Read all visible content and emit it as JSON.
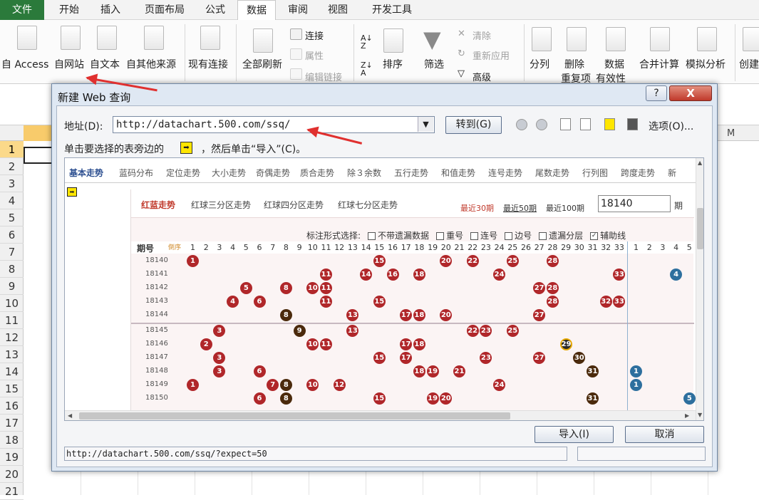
{
  "ribbon_tabs": [
    "文件",
    "开始",
    "插入",
    "页面布局",
    "公式",
    "数据",
    "审阅",
    "视图",
    "开发工具"
  ],
  "ribbon": {
    "access": "自 Access",
    "web": "自网站",
    "text": "自文本",
    "other": "自其他来源",
    "existing": "现有连接",
    "refresh_all": "全部刷新",
    "connections": "连接",
    "properties": "属性",
    "edit_links": "编辑链接",
    "sort": "排序",
    "filter": "筛选",
    "clear": "清除",
    "reapply": "重新应用",
    "advanced": "高级",
    "split": "分列",
    "remove_dup_1": "删除",
    "remove_dup_2": "重复项",
    "validation_1": "数据",
    "validation_2": "有效性",
    "consolidate": "合并计算",
    "what_if": "模拟分析",
    "create": "创建"
  },
  "sheet": {
    "rows": [
      "1",
      "2",
      "3",
      "4",
      "5",
      "6",
      "7",
      "8",
      "9",
      "10",
      "11",
      "12",
      "13",
      "14",
      "15",
      "16",
      "17",
      "18",
      "19",
      "20",
      "21"
    ],
    "col_m": "M"
  },
  "dialog": {
    "title": "新建 Web 查询",
    "help": "?",
    "close": "X",
    "address_label": "地址(D):",
    "address_value": "http://datachart.500.com/ssq/",
    "go_button": "转到(G)",
    "options_label": "选项(O)...",
    "hint_before": "单击要选择的表旁边的",
    "hint_after": "，然后单击“导入”(C)。",
    "import_button": "导入(I)",
    "cancel_button": "取消",
    "status_url": "http://datachart.500.com/ssq/?expect=50"
  },
  "web": {
    "tabs": [
      "基本走势",
      "蓝码分布",
      "定位走势",
      "大小走势",
      "奇偶走势",
      "质合走势",
      "除３余数",
      "五行走势",
      "和值走势",
      "连号走势",
      "尾数走势",
      "行列图",
      "跨度走势",
      "新"
    ],
    "subtabs": [
      "红蓝走势",
      "红球三分区走势",
      "红球四分区走势",
      "红球七分区走势"
    ],
    "recent30": "最近30期",
    "recent50": "最近50期",
    "recent100": "最近100期",
    "issue_input": "18140",
    "issue_label": "期",
    "mark_label": "标注形式选择:",
    "options": [
      {
        "label": "不带遗漏数据",
        "checked": false
      },
      {
        "label": "重号",
        "checked": false
      },
      {
        "label": "连号",
        "checked": false
      },
      {
        "label": "边号",
        "checked": false
      },
      {
        "label": "遗漏分层",
        "checked": false
      },
      {
        "label": "辅助线",
        "checked": true
      }
    ],
    "col_issue": "期号",
    "col_sort": "倒序",
    "red_cols": [
      "1",
      "2",
      "3",
      "4",
      "5",
      "6",
      "7",
      "8",
      "9",
      "10",
      "11",
      "12",
      "13",
      "14",
      "15",
      "16",
      "17",
      "18",
      "19",
      "20",
      "21",
      "22",
      "23",
      "24",
      "25",
      "26",
      "27",
      "28",
      "29",
      "30",
      "31",
      "32",
      "33"
    ],
    "blue_cols": [
      "1",
      "2",
      "3",
      "4",
      "5"
    ],
    "draws": [
      {
        "issue": "18140",
        "red": [
          1,
          15,
          20,
          22,
          25,
          28
        ],
        "blue": []
      },
      {
        "issue": "18141",
        "red": [
          11,
          14,
          16,
          18,
          24,
          33
        ],
        "blue": [
          4
        ]
      },
      {
        "issue": "18142",
        "red": [
          5,
          8,
          10,
          11,
          27,
          28
        ],
        "blue": []
      },
      {
        "issue": "18143",
        "red": [
          4,
          6,
          11,
          15,
          28,
          32,
          33
        ],
        "blue": []
      },
      {
        "issue": "18144",
        "red": [
          8,
          13,
          17,
          18,
          20,
          27
        ],
        "blue": []
      },
      {
        "issue": "18145",
        "red": [
          3,
          9,
          13,
          22,
          23,
          25
        ],
        "blue": []
      },
      {
        "issue": "18146",
        "red": [
          2,
          10,
          11,
          17,
          18,
          29
        ],
        "blue": []
      },
      {
        "issue": "18147",
        "red": [
          3,
          15,
          17,
          23,
          27,
          30
        ],
        "blue": []
      },
      {
        "issue": "18148",
        "red": [
          3,
          6,
          18,
          19,
          21,
          31
        ],
        "blue": [
          1
        ]
      },
      {
        "issue": "18149",
        "red": [
          1,
          7,
          8,
          10,
          12,
          24
        ],
        "blue": [
          1
        ]
      },
      {
        "issue": "18150",
        "red": [
          6,
          8,
          15,
          19,
          20,
          31
        ],
        "blue": [
          5
        ]
      }
    ]
  }
}
